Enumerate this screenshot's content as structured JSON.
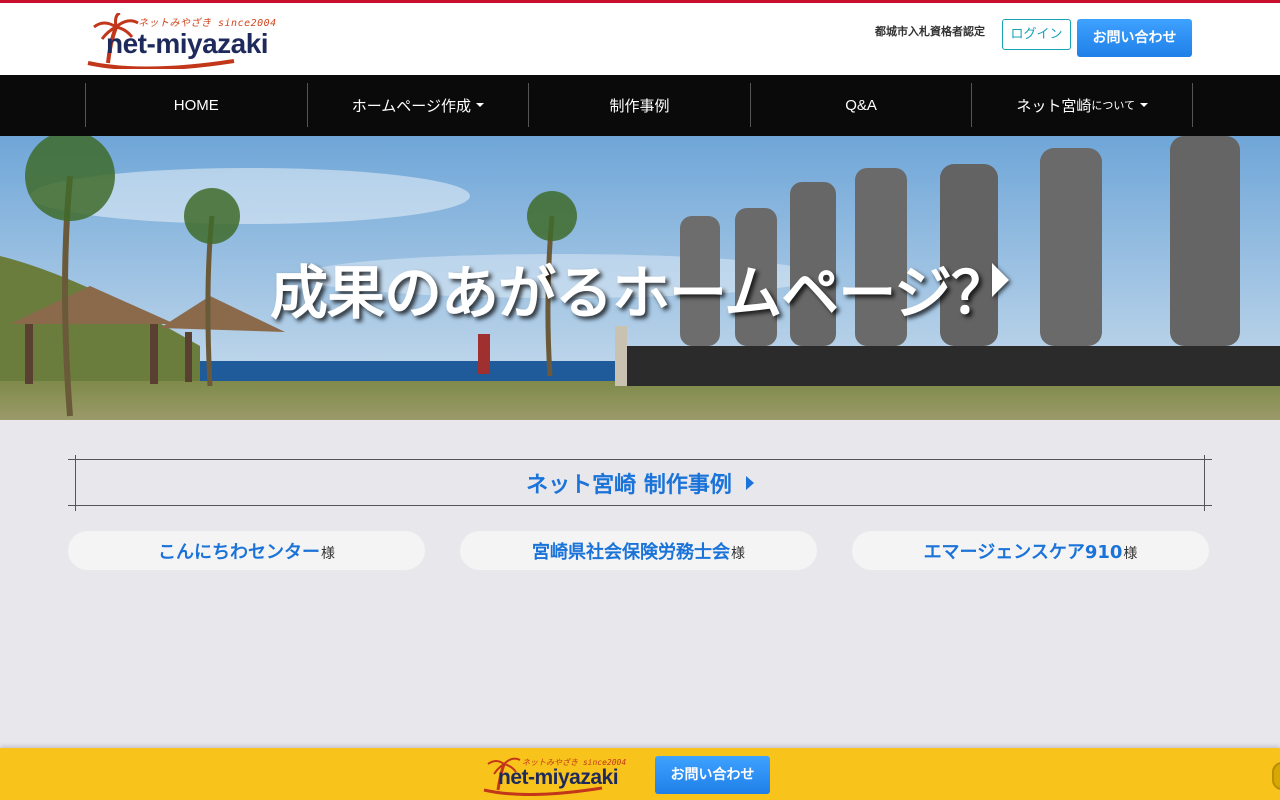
{
  "header": {
    "logo": {
      "tagline": "ネットみやざき since2004",
      "wordmark": "net-miyazaki"
    },
    "certification": "都城市入札資格者認定",
    "login_label": "ログイン",
    "contact_label": "お問い合わせ"
  },
  "nav": {
    "items": [
      {
        "label": "HOME",
        "has_dropdown": false
      },
      {
        "label": "ホームページ作成",
        "has_dropdown": true
      },
      {
        "label": "制作事例",
        "has_dropdown": false
      },
      {
        "label": "Q&A",
        "has_dropdown": false
      },
      {
        "label": "ネット宮崎",
        "suffix": "について",
        "has_dropdown": true
      }
    ]
  },
  "hero": {
    "title": "成果のあがるホームページ？"
  },
  "works_section": {
    "title": "ネット宮崎 制作事例",
    "items": [
      {
        "name": "こんにちわセンター",
        "honorific": "様"
      },
      {
        "name": "宮崎県社会保険労務士会",
        "honorific": "様"
      },
      {
        "name": "エマージェンスケア910",
        "honorific": "様"
      }
    ]
  },
  "bottom_bar": {
    "logo": {
      "tagline": "ネットみやざき since2004",
      "wordmark": "net-miyazaki"
    },
    "contact_label": "お問い合わせ"
  },
  "colors": {
    "top_line": "#c8102e",
    "nav_bg": "#0a0a0a",
    "accent_blue": "#1a73d9",
    "contact_button": "#2d8cf0",
    "login_border": "#17a2b8",
    "bottom_bar": "#f8c41c",
    "page_bg": "#e8e7ec"
  },
  "icons": [
    "palm-tree-logo-icon",
    "caret-down-icon",
    "play-arrow-icon"
  ]
}
